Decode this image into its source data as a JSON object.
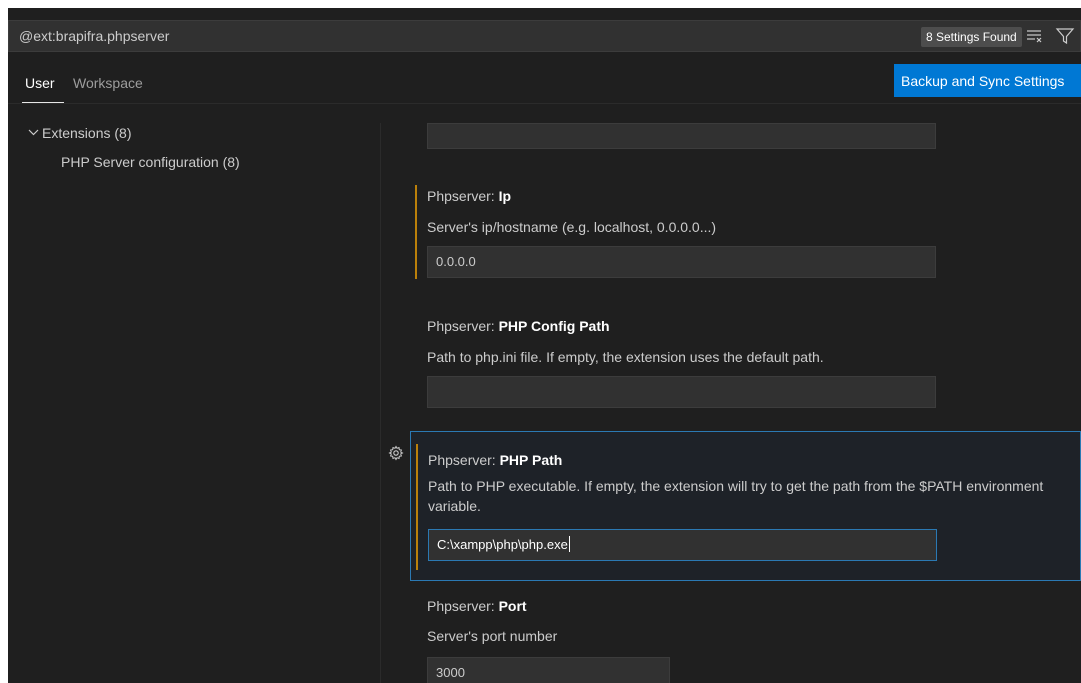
{
  "search": {
    "query": "@ext:brapifra.phpserver",
    "results_badge": "8 Settings Found",
    "clear_filter_icon": "clear-filter-icon",
    "filter_icon": "funnel-icon"
  },
  "tabs": {
    "user": "User",
    "workspace": "Workspace",
    "active": "User"
  },
  "sync_button": "Backup and Sync Settings",
  "toc": {
    "extensions": "Extensions (8)",
    "php_server": "PHP Server configuration (8)"
  },
  "settings": {
    "ip": {
      "prefix": "Phpserver: ",
      "name": "Ip",
      "description": "Server's ip/hostname (e.g. localhost, 0.0.0.0...)",
      "value": "0.0.0.0"
    },
    "config_path": {
      "prefix": "Phpserver: ",
      "name": "PHP Config Path",
      "description": "Path to php.ini file. If empty, the extension uses the default path.",
      "value": ""
    },
    "php_path": {
      "prefix": "Phpserver: ",
      "name": "PHP Path",
      "description": "Path to PHP executable. If empty, the extension will try to get the path from the $PATH environment variable.",
      "value": "C:\\xampp\\php\\php.exe"
    },
    "port": {
      "prefix": "Phpserver: ",
      "name": "Port",
      "description": "Server's port number",
      "value": "3000"
    }
  },
  "colors": {
    "accent": "#0078d4",
    "modified": "#bb800a",
    "focus_border": "#2b79b3",
    "background": "#1f1f1f"
  }
}
